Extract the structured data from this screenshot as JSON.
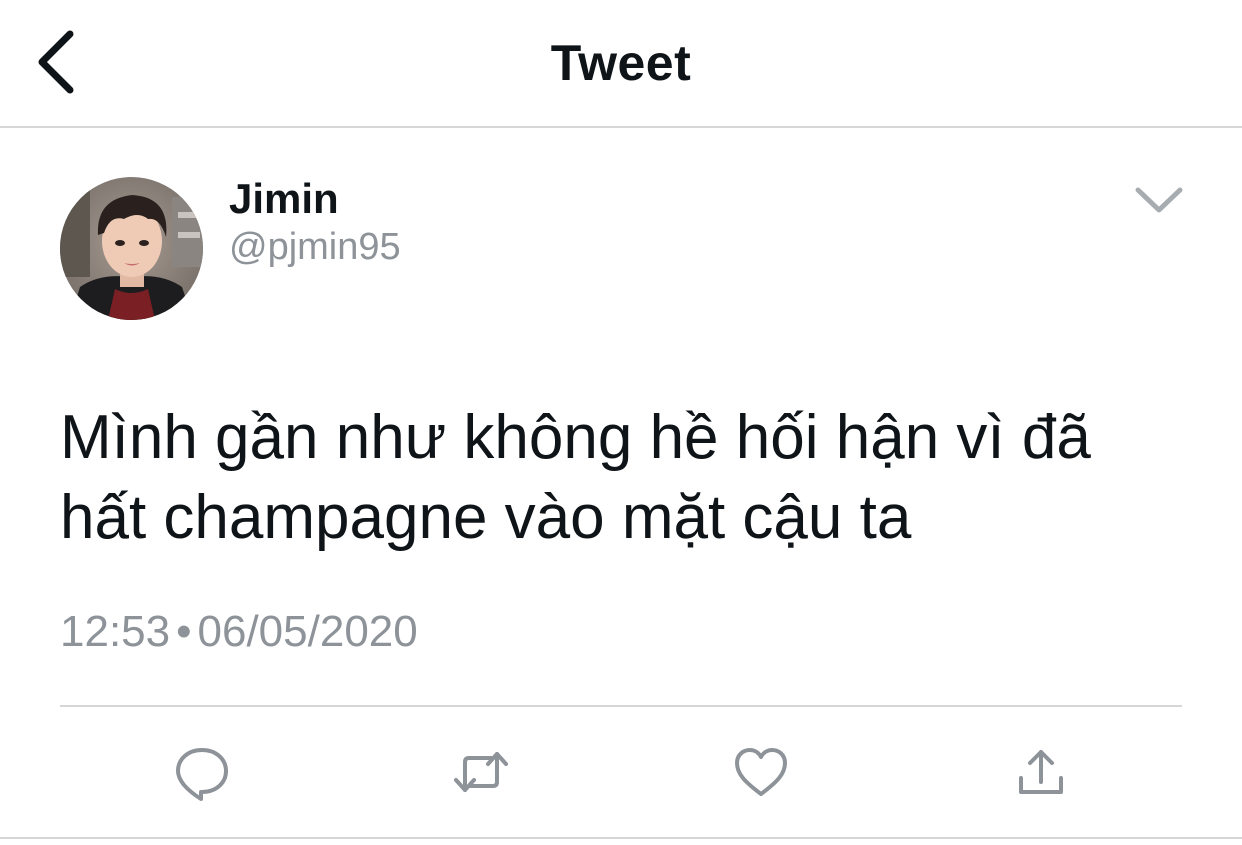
{
  "header": {
    "title": "Tweet"
  },
  "tweet": {
    "author": {
      "display_name": "Jimin",
      "username": "@pjmin95"
    },
    "text_line_1": "Mình gần như không hề hối hận vì đã",
    "text_line_2": "hất champagne vào mặt cậu ta",
    "time": "12:53",
    "separator": "•",
    "date": "06/05/2020"
  },
  "actions": {
    "reply_icon": "reply-icon",
    "retweet_icon": "retweet-icon",
    "like_icon": "heart-icon",
    "share_icon": "share-icon"
  },
  "colors": {
    "text": "#0f1419",
    "muted": "#8d9399",
    "icon": "#8d9399",
    "divider": "#d6d6d6"
  }
}
